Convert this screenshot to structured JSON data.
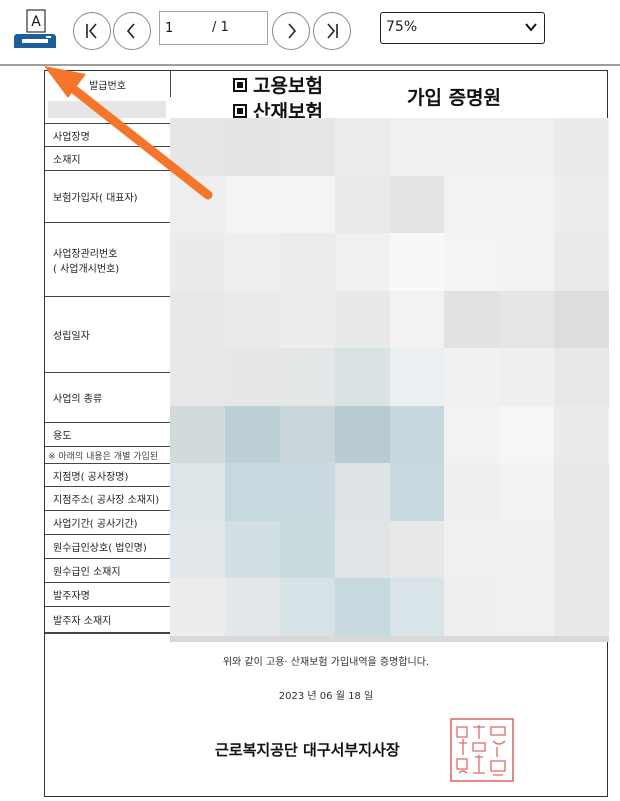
{
  "toolbar": {
    "print_glyph": "A",
    "page_current": "1",
    "page_total": "/ 1",
    "zoom_value": "75%"
  },
  "document": {
    "reg_label": "발급번호",
    "labels": [
      "사업장명",
      "소재지",
      "보험가입자( 대표자)",
      "사업장관리번호\n( 사업개시번호)",
      "성립일자",
      "사업의 종류",
      "용도"
    ],
    "note": "※ 아래의 내용은 개별 가입된",
    "labels2": [
      "지점명( 공사장명)",
      "지점주소( 공사장 소재지)",
      "사업기간( 공사기간)",
      "원수급인상호( 법인명)",
      "원수급인 소재지",
      "발주자명",
      "발주자 소재지"
    ],
    "insurance_1": "고용보험",
    "insurance_2": "산재보험",
    "title": "가입 증명원",
    "confirm_text": "위와 같이 고용· 산재보험 가입내역을 증명합니다.",
    "date_text": "2023 년 06 월 18 일",
    "issuer": "근로복지공단 대구서부지사장"
  },
  "colors": {
    "arrow": "#f5762a",
    "printer": "#1d5f9a",
    "seal": "#e06a6a"
  }
}
